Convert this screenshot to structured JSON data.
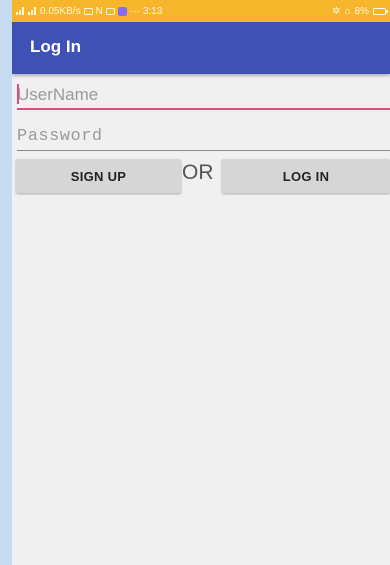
{
  "status_bar": {
    "network_speed": "0.05KB/s",
    "time": "3:13",
    "dots": "···",
    "bluetooth": "✲",
    "alarm": "⌂",
    "battery": "8%",
    "net_label": "N"
  },
  "app_bar": {
    "title": "Log In"
  },
  "form": {
    "username_placeholder": "UserName",
    "username_value": "",
    "password_placeholder": "Password",
    "password_value": "",
    "signup_label": "SIGN UP",
    "or_label": "OR",
    "login_label": "LOG IN"
  },
  "colors": {
    "status_bar": "#f7b52b",
    "app_bar": "#3f51b5",
    "accent": "#e8457a",
    "background": "#f0f0f0",
    "outer_background": "#c5dcf2"
  }
}
